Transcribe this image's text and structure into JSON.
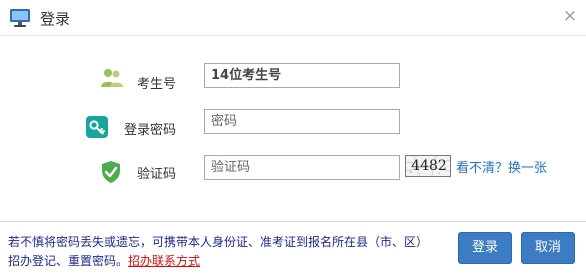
{
  "dialog": {
    "title": "登录",
    "close_glyph": "×",
    "title_icon": "monitor-icon"
  },
  "form": {
    "exam_no": {
      "label": "考生号",
      "placeholder": "14位考生号",
      "icon": "users-icon"
    },
    "password": {
      "label": "登录密码",
      "placeholder": "密码",
      "icon": "key-icon"
    },
    "captcha": {
      "label": "验证码",
      "placeholder": "验证码",
      "icon": "shield-check-icon",
      "code": "4482",
      "refresh_label": "看不清？换一张"
    }
  },
  "footer": {
    "notice": "若不慎将密码丢失或遗忘，可携带本人身份证、准考证到报名所在县（市、区）招办登记、重置密码。",
    "notice_link": "招办联系方式",
    "login_label": "登录",
    "cancel_label": "取消"
  },
  "colors": {
    "accent": "#3c7cc2",
    "notice_text": "#1f2a8a",
    "link_red": "#d01010",
    "link_blue": "#2a73b8",
    "shield_green": "#4cae4c",
    "key_teal": "#1aa59a"
  }
}
